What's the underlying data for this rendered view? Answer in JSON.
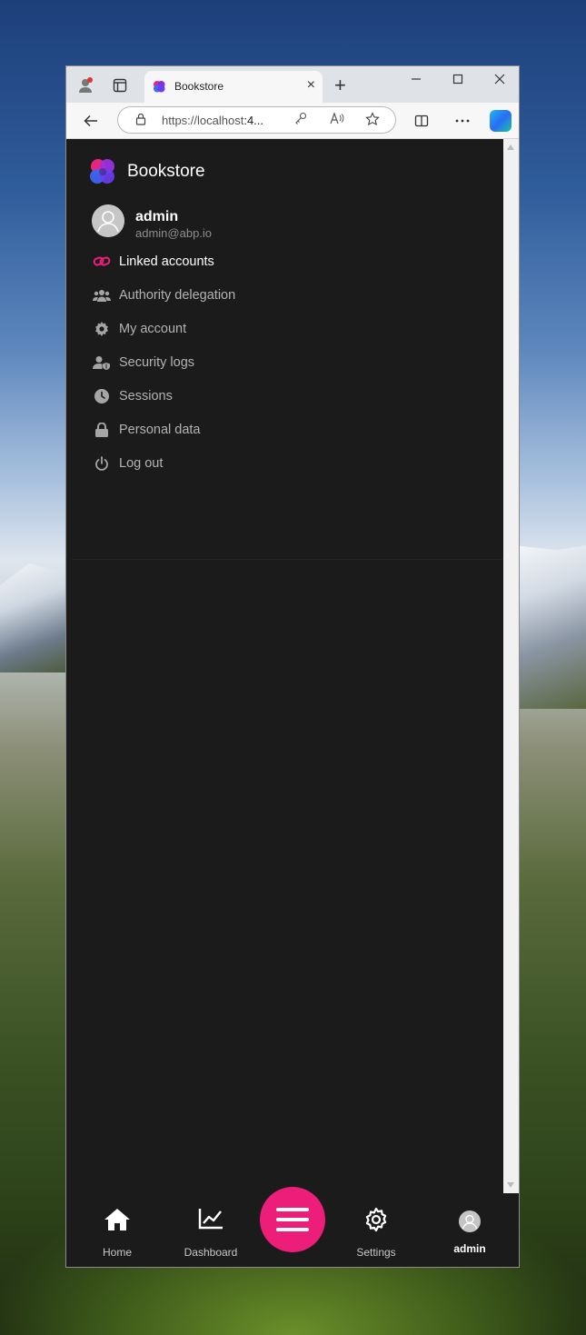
{
  "browser": {
    "tab_title": "Bookstore",
    "url_host": "https://localhost",
    "url_rest": ":4...",
    "close_tab_glyph": "×",
    "new_tab_glyph": "+"
  },
  "app": {
    "brand": "Bookstore",
    "user": {
      "name": "admin",
      "email": "admin@abp.io"
    },
    "menu": [
      {
        "label": "Linked accounts",
        "icon": "link-icon"
      },
      {
        "label": "Authority delegation",
        "icon": "users-icon"
      },
      {
        "label": "My account",
        "icon": "gear-icon"
      },
      {
        "label": "Security logs",
        "icon": "user-shield-icon"
      },
      {
        "label": "Sessions",
        "icon": "clock-icon"
      },
      {
        "label": "Personal data",
        "icon": "lock-icon"
      },
      {
        "label": "Log out",
        "icon": "power-icon"
      }
    ],
    "bottom_nav": {
      "home": "Home",
      "dashboard": "Dashboard",
      "settings": "Settings",
      "user": "admin"
    }
  },
  "colors": {
    "accent": "#ec1e79",
    "background": "#1b1b1b"
  }
}
